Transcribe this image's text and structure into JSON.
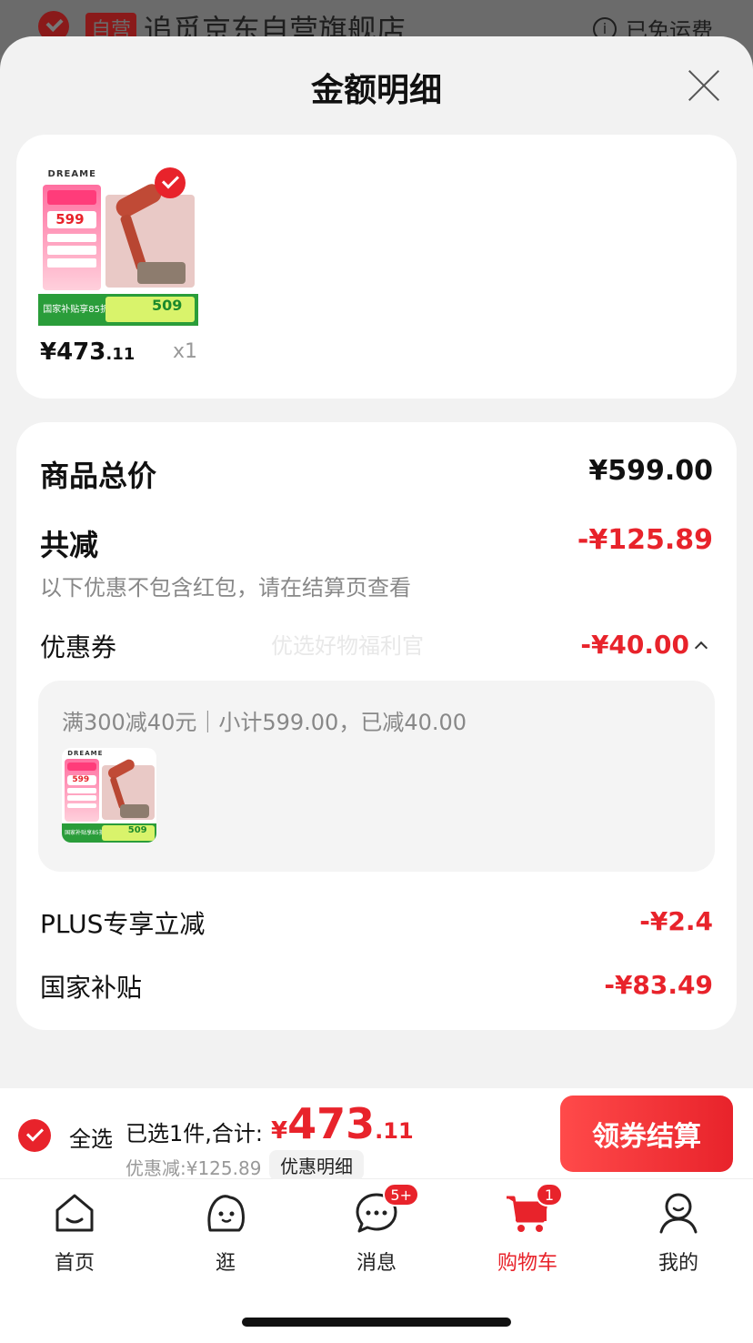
{
  "background_header": {
    "tag": "自营",
    "store_name": "追觅京东自营旗舰店",
    "shipping": "已免运费"
  },
  "sheet": {
    "title": "金额明细"
  },
  "product": {
    "brand": "DREAME",
    "thumb_price": "599",
    "thumb_subsidy": "509",
    "thumb_label": "国家补贴享85折",
    "price_main": "¥473",
    "price_dec": ".11",
    "quantity": "x1"
  },
  "breakdown": {
    "total_label": "商品总价",
    "total_value": "¥599.00",
    "discount_label": "共减",
    "discount_value": "-¥125.89",
    "discount_note": "以下优惠不包含红包，请在结算页查看",
    "watermark": "优选好物福利官",
    "coupon_label": "优惠券",
    "coupon_value": "-¥40.00",
    "coupon_desc": "满300减40元｜小计599.00，已减40.00",
    "plus_label": "PLUS专享立减",
    "plus_value": "-¥2.4",
    "subsidy_label": "国家补贴",
    "subsidy_value": "-¥83.49"
  },
  "bottom_bar": {
    "select_all": "全选",
    "selected_text": "已选1件,合计:",
    "total_currency": "¥",
    "total_int": "473",
    "total_dec": ".11",
    "discount_text": "优惠减:¥125.89",
    "detail_tag": "优惠明细",
    "checkout": "领券结算"
  },
  "tabs": [
    {
      "label": "首页",
      "icon": "home-icon"
    },
    {
      "label": "逛",
      "icon": "browse-face-icon"
    },
    {
      "label": "消息",
      "icon": "message-icon",
      "badge": "5+"
    },
    {
      "label": "购物车",
      "icon": "cart-icon",
      "badge": "1",
      "active": true
    },
    {
      "label": "我的",
      "icon": "profile-icon"
    }
  ],
  "colors": {
    "accent": "#e8232b"
  }
}
